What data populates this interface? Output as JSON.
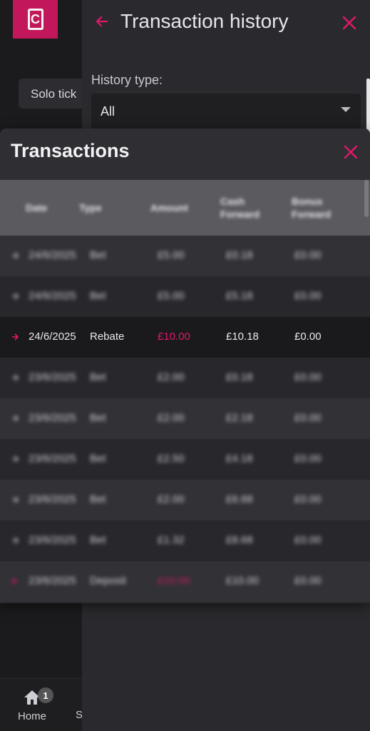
{
  "app": {
    "logo_letter": "C",
    "solo_chip": "Solo tick",
    "nav": {
      "home_label": "Home",
      "home_badge": "1",
      "partial_label": "S"
    }
  },
  "panel": {
    "title": "Transaction history",
    "history_type_label": "History type:",
    "history_type_value": "All"
  },
  "modal": {
    "title": "Transactions",
    "columns": [
      "Date",
      "Type",
      "Amount",
      "Cash",
      "Forward",
      "Bonus",
      "Forward"
    ],
    "rows": [
      {
        "date": "24/6/2025",
        "type": "Bet",
        "amount": "£5.00",
        "cash_forward": "£0.18",
        "bonus_forward": "£0.00"
      },
      {
        "date": "24/6/2025",
        "type": "Bet",
        "amount": "£5.00",
        "cash_forward": "£5.18",
        "bonus_forward": "£0.00"
      },
      {
        "date": "24/6/2025",
        "type": "Rebate",
        "amount": "£10.00",
        "cash_forward": "£10.18",
        "bonus_forward": "£0.00"
      },
      {
        "date": "23/6/2025",
        "type": "Bet",
        "amount": "£2.00",
        "cash_forward": "£0.18",
        "bonus_forward": "£0.00"
      },
      {
        "date": "23/6/2025",
        "type": "Bet",
        "amount": "£2.00",
        "cash_forward": "£2.18",
        "bonus_forward": "£0.00"
      },
      {
        "date": "23/6/2025",
        "type": "Bet",
        "amount": "£2.50",
        "cash_forward": "£4.18",
        "bonus_forward": "£0.00"
      },
      {
        "date": "23/6/2025",
        "type": "Bet",
        "amount": "£2.00",
        "cash_forward": "£6.68",
        "bonus_forward": "£0.00"
      },
      {
        "date": "23/6/2025",
        "type": "Bet",
        "amount": "£1.32",
        "cash_forward": "£8.68",
        "bonus_forward": "£0.00"
      },
      {
        "date": "23/6/2025",
        "type": "Deposit",
        "amount": "£10.00",
        "cash_forward": "£10.00",
        "bonus_forward": "£0.00"
      }
    ]
  },
  "colors": {
    "accent": "#e0186a",
    "brand": "#c2185b"
  },
  "icons": {
    "back": "arrow-left-icon",
    "close": "close-icon",
    "select": "caret-down-icon",
    "home": "home-icon",
    "row": "arrow-right-icon"
  }
}
